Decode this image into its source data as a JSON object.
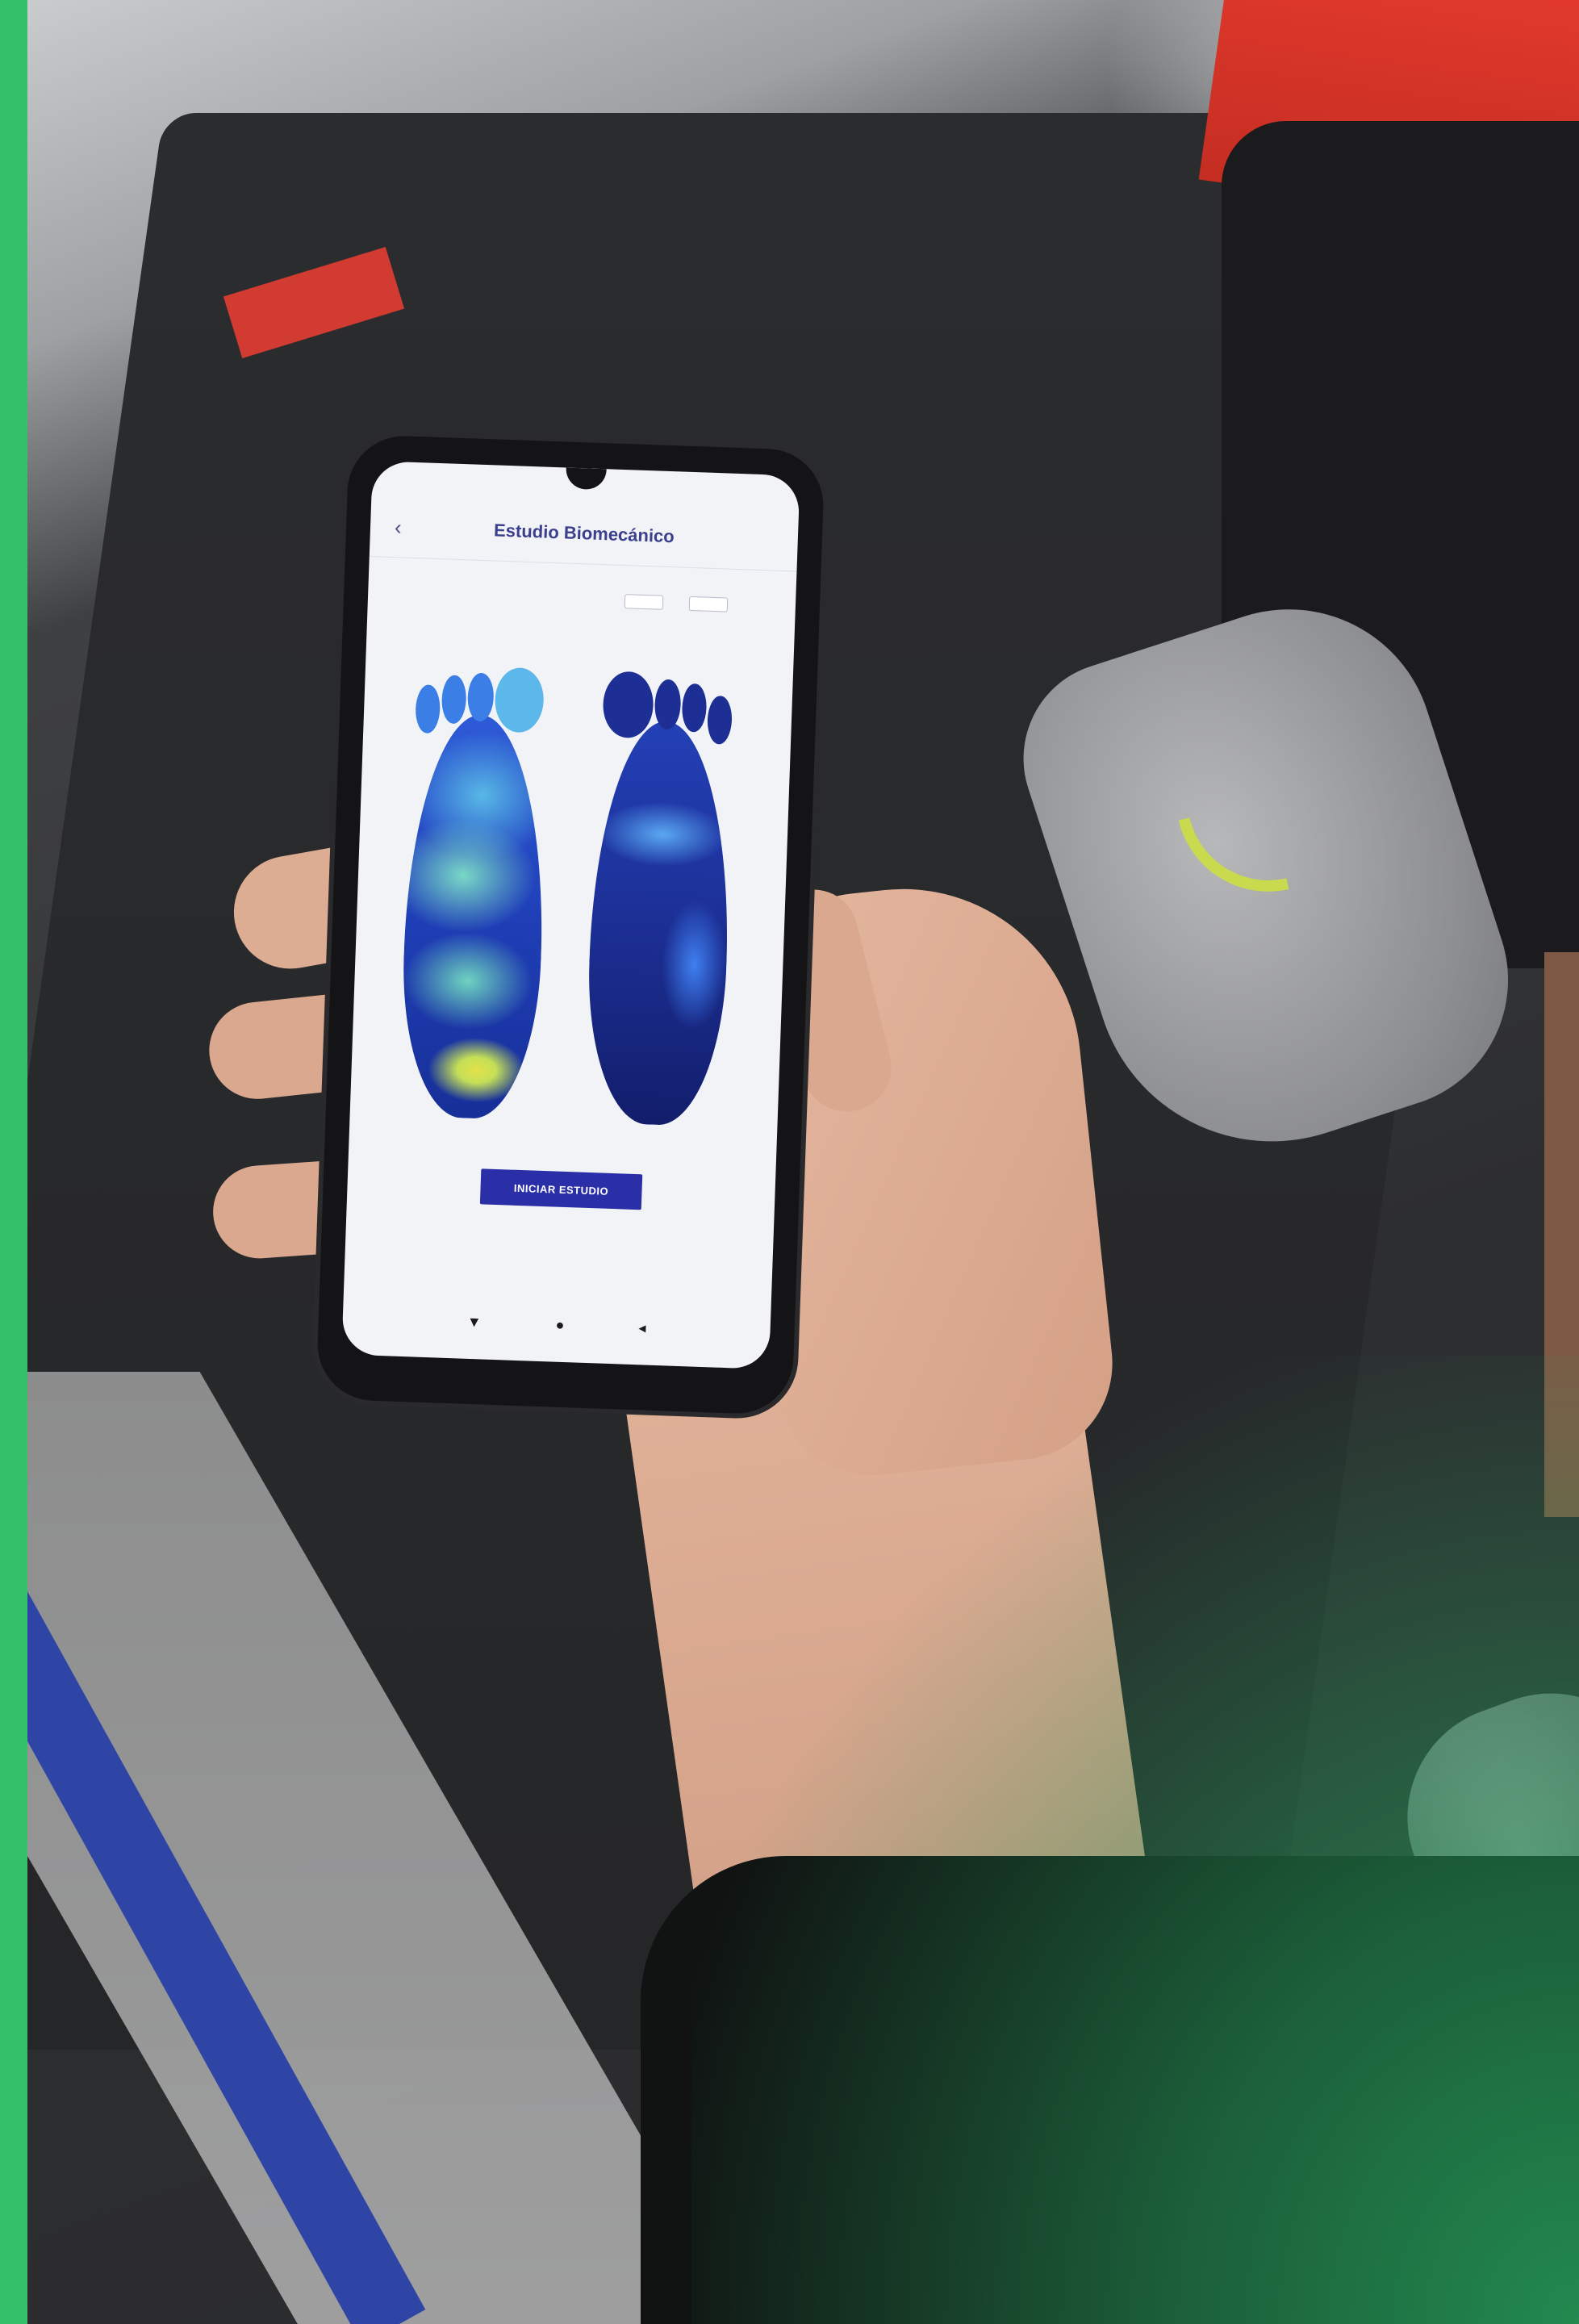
{
  "app": {
    "status_time": "",
    "status_icons": "",
    "title": "Estudio Biomecánico",
    "back_icon": "arrow-left-icon",
    "patient_name": "",
    "patient_sub": "",
    "toggle_left_label": "",
    "toggle_right_label": "",
    "start_button_label": "INICIAR ESTUDIO"
  },
  "nav": {
    "back_icon": "nav-back-icon",
    "home_icon": "nav-home-icon",
    "recents_icon": "nav-recents-icon"
  },
  "colors": {
    "accent": "#35c06c",
    "title": "#3c3f8c",
    "button": "#2a2fa8"
  }
}
